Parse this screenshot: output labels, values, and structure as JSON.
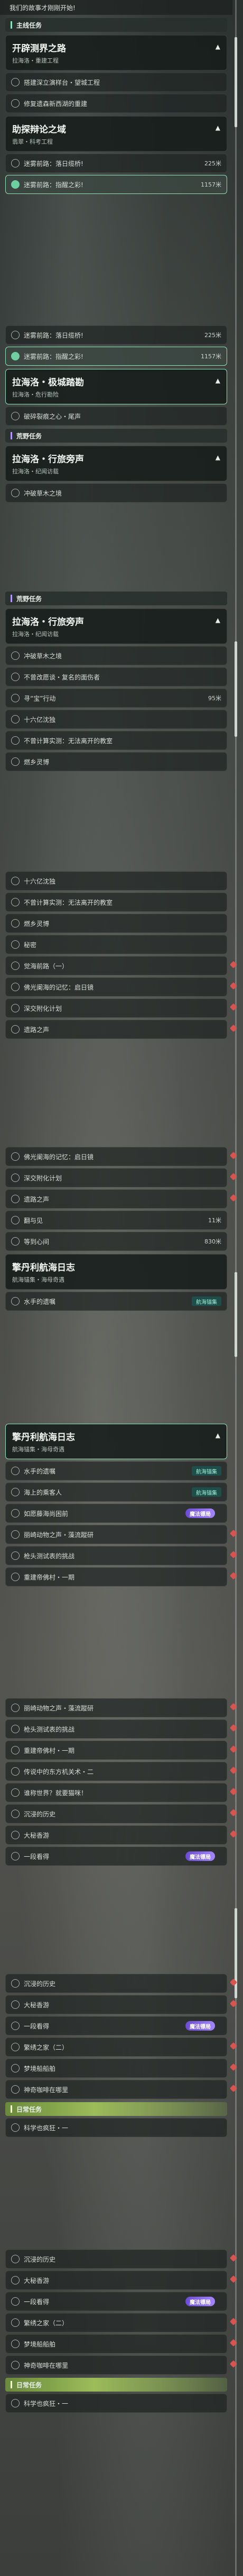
{
  "top_notice": "我们的故事才刚刚开始!",
  "sections": {
    "main_quest": "主线任务",
    "wild_quest": "荒野任务",
    "daily_quest": "日常任务"
  },
  "quest_cards": [
    {
      "title": "开辟测界之路",
      "sub": "拉海洛・重建工程"
    },
    {
      "title": "助探辩论之域",
      "sub": "翡翠・科考工程"
    },
    {
      "title": "拉海洛・极城踏勘",
      "sub": "拉海洛・危行勘险"
    },
    {
      "title": "拉海洛・行旅旁声",
      "sub": "拉海洛・纪闻访载"
    },
    {
      "title": "拉海洛・行旅旁声",
      "sub": "拉海洛・纪闻访载"
    },
    {
      "title": "擎丹利航海日志",
      "sub": "航海锚集・海母奇遇"
    },
    {
      "title": "擎丹利航海日志",
      "sub": "航海锚集・海母奇遇"
    }
  ],
  "items": {
    "s1": [
      "搭建深立演样台・望城工程",
      "修复遗森新西湖的重建"
    ],
    "s2": [
      {
        "t": "迷雾前路：落日缆桥!",
        "d": "225米"
      },
      {
        "t": "迷雾前路：指醒之彩!",
        "d": "1157米"
      }
    ],
    "s3": [
      {
        "t": "迷雾前路：落日缆桥!",
        "d": "225米"
      },
      {
        "t": "迷雾前路：指醒之彩!",
        "d": "1157米"
      }
    ],
    "s4": [
      "破碎裂痕之心・尾声"
    ],
    "s5": [
      "冲破草木之境"
    ],
    "s6": [
      "冲破草木之境",
      "不曾改愿谈・复名的面伤者",
      {
        "t": "寻“宝”行动",
        "d": "95米"
      },
      "十六亿沈独",
      "不曾计算实测：无法离开的教室",
      "燃乡灵博"
    ],
    "s7": [
      "十六亿沈独",
      "不曾计算实测：无法离开的教室",
      "燃乡灵博",
      "秘密",
      "觉海前路（一）",
      "佛光阑海的记忆：启日镜",
      "深交附化计划",
      "遗路之声"
    ],
    "s8": [
      "佛光阑海的记忆：启日镜",
      "深交附化计划",
      "遗路之声",
      {
        "t": "翻与见",
        "d": "11米"
      },
      {
        "t": "等到心间",
        "d": "830米"
      }
    ],
    "s9": [
      "水手的遗嘱"
    ],
    "s10": [
      "水手的遗嘱",
      "海上的乘客人",
      "如愿藤海尚困前",
      "丽崎动物之声・藻流蹤研",
      "枪头测试表的挑战",
      "重建帝佛村・一期",
      "丽崎动物之声・藻流蹤研",
      "枪头测试表的挑战",
      "重建帝佛村・一期",
      "传说中的东方机关术・二",
      "谁称世界？就要猫咪！",
      "沉浸的历史",
      "大秘香游",
      "一段看得"
    ],
    "s11": [
      "沉浸的历史",
      "大秘香游",
      "一段看得",
      "繁绣之家（二）",
      "梦境船船舶",
      "神奇咖啡在哪里"
    ],
    "s12": [
      "科学也疯狂・一"
    ],
    "s13": [
      "沉浸的历史",
      "大秘香游",
      "一段看得",
      "繁绣之家（二）",
      "梦境船船舶",
      "神奇咖啡在哪里"
    ],
    "s14": [
      "科学也疯狂・一"
    ]
  },
  "tags": {
    "purple": "魔法镖局",
    "teal": "航海锚集"
  },
  "colors": {
    "accent": "#8fe3b6",
    "purple": "#a485ff",
    "daily": "#9cbc5a",
    "alert": "#d9534f"
  }
}
